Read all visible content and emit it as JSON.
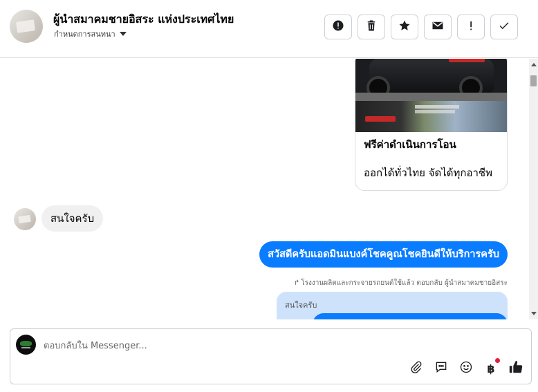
{
  "header": {
    "title": "ผู้นำสมาคมชายอิสระ แห่งประเทศไทย",
    "subtitle": "กำหนดการสนทนา",
    "actions": [
      {
        "name": "alert-icon"
      },
      {
        "name": "trash-icon"
      },
      {
        "name": "star-icon"
      },
      {
        "name": "mail-icon"
      },
      {
        "name": "exclamation-icon"
      },
      {
        "name": "check-icon"
      }
    ]
  },
  "messages": {
    "card": {
      "title": "ฟรีค่าดำเนินการโอน",
      "description": "ออกได้ทั่วไทย จัดได้ทุกอาชีพ"
    },
    "incoming_text": "สนใจครับ",
    "outgoing_text": "สวัสดีครับแอดมินแบงค์โชคคูณโชคยินดีให้บริการครับ",
    "reply_note": "โรงงานผลิตและกระจายรถยนต์ใช้แล้ว ตอบกลับ ผู้นำสมาคมชายอิสระ",
    "reply_quote": "สนใจครับ"
  },
  "composer": {
    "placeholder": "ตอบกลับใน Messenger...",
    "tools": [
      "attachment-icon",
      "chat-bubble-icon",
      "emoji-icon",
      "baht-icon",
      "thumbs-up-icon"
    ],
    "baht_symbol": "฿"
  },
  "colors": {
    "accent": "#0a7cff",
    "incoming_bubble": "#f0f0f0",
    "reply_quote": "#cfe2fb",
    "notification": "#e41e3f"
  }
}
